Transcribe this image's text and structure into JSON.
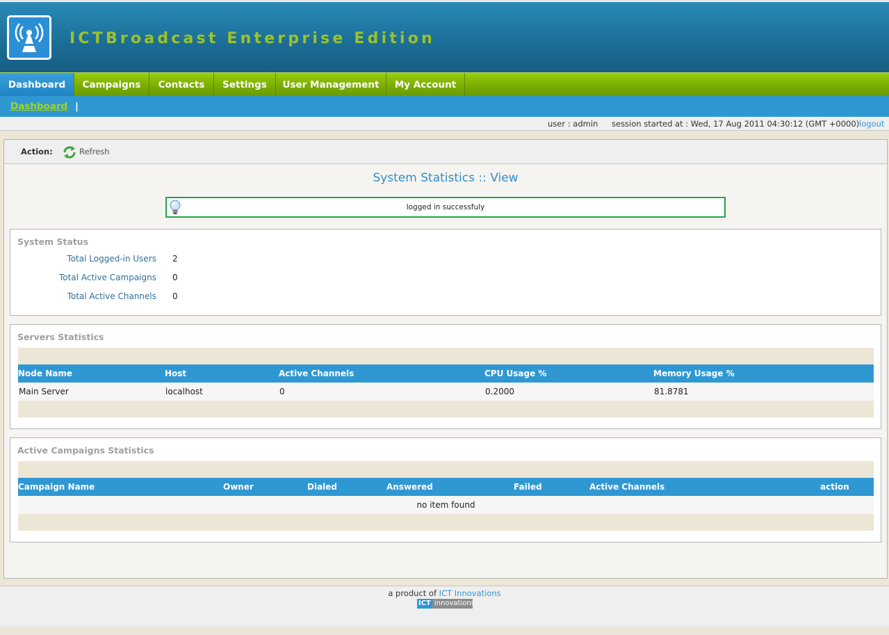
{
  "app": {
    "title": "ICTBroadcast Enterprise Edition",
    "logo_icon": "broadcast-antenna-icon"
  },
  "nav": {
    "tabs": [
      {
        "label": "Dashboard",
        "active": true
      },
      {
        "label": "Campaigns",
        "active": false
      },
      {
        "label": "Contacts",
        "active": false
      },
      {
        "label": "Settings",
        "active": false
      },
      {
        "label": "User Management",
        "active": false
      },
      {
        "label": "My Account",
        "active": false
      }
    ]
  },
  "subnav": {
    "link": "Dashboard",
    "separator": "|"
  },
  "userbar": {
    "user": "user : admin",
    "session": "session started at : Wed, 17 Aug 2011 04:30:12 (GMT +0000)",
    "logout": "logout"
  },
  "actionbar": {
    "label": "Action:",
    "refresh": "Refresh"
  },
  "page": {
    "heading": "System Statistics :: View"
  },
  "message": {
    "text": "logged in successfuly"
  },
  "system_status": {
    "title": "System Status",
    "rows": [
      {
        "label": "Total Logged-in Users",
        "value": "2"
      },
      {
        "label": "Total Active Campaigns",
        "value": "0"
      },
      {
        "label": "Total Active Channels",
        "value": "0"
      }
    ]
  },
  "servers": {
    "title": "Servers Statistics",
    "columns": [
      "Node Name",
      "Host",
      "Active Channels",
      "CPU Usage %",
      "Memory Usage %"
    ],
    "rows": [
      [
        "Main Server",
        "localhost",
        "0",
        "0.2000",
        "81.8781"
      ]
    ]
  },
  "campaigns": {
    "title": "Active Campaigns Statistics",
    "columns": [
      "Campaign Name",
      "Owner",
      "Dialed",
      "Answered",
      "Failed",
      "Active Channels",
      "action"
    ],
    "empty_text": "no item found"
  },
  "footer": {
    "prefix": "a product of ",
    "link": "ICT Innovations",
    "logo_a": "ICT",
    "logo_b": "innovations"
  },
  "colors": {
    "accent_blue": "#2f98d3",
    "nav_green": "#7cb002",
    "title_green": "#9cc22a",
    "success_border": "#1ea64a"
  }
}
